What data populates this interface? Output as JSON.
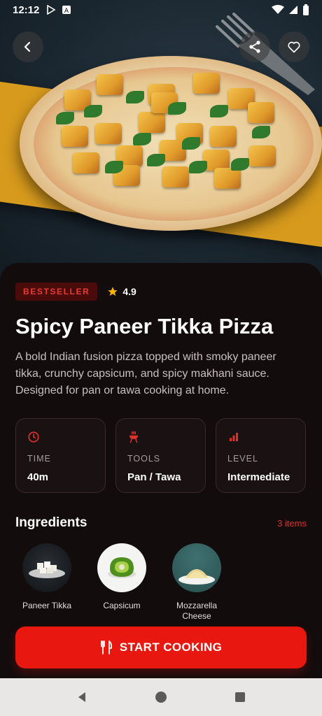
{
  "status_bar": {
    "time": "12:12"
  },
  "recipe": {
    "badge": "BESTSELLER",
    "rating": "4.9",
    "title": "Spicy Paneer Tikka Pizza",
    "description": "A bold Indian fusion pizza topped with smoky paneer tikka, crunchy capsicum, and spicy makhani sauce. Designed for pan or tawa cooking at home."
  },
  "stats": [
    {
      "label": "TIME",
      "value": "40m",
      "icon": "clock-icon"
    },
    {
      "label": "TOOLS",
      "value": "Pan / Tawa",
      "icon": "grill-icon"
    },
    {
      "label": "LEVEL",
      "value": "Intermediate",
      "icon": "signal-bars-icon"
    }
  ],
  "ingredients": {
    "title": "Ingredients",
    "count": "3 items",
    "items": [
      {
        "name": "Paneer Tikka"
      },
      {
        "name": "Capsicum"
      },
      {
        "name": "Mozzarella Cheese"
      }
    ]
  },
  "cta": {
    "label": "START COOKING",
    "icon": "fork-knife-icon"
  },
  "colors": {
    "accent": "#e8170f",
    "background": "#120c0c",
    "badge_bg": "#4a0b0b",
    "star": "#f5b400"
  }
}
